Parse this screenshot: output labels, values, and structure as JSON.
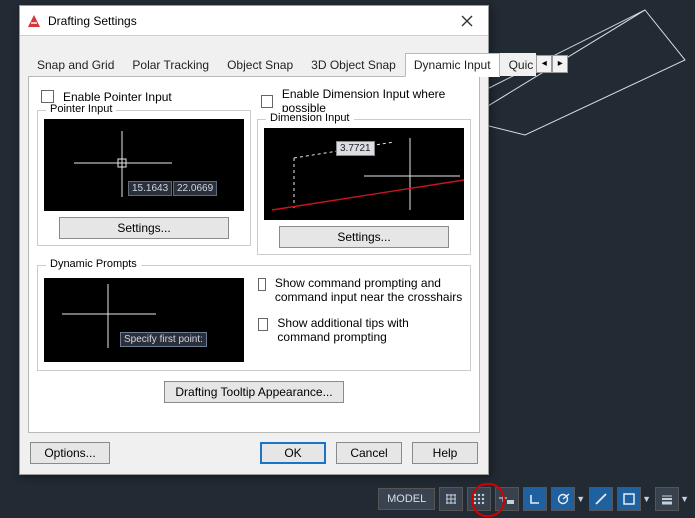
{
  "dialog": {
    "title": "Drafting Settings",
    "tabs": [
      "Snap and Grid",
      "Polar Tracking",
      "Object Snap",
      "3D Object Snap",
      "Dynamic Input",
      "Quic"
    ],
    "active_tab": "Dynamic Input",
    "enable_pointer": "Enable Pointer Input",
    "enable_dim": "Enable Dimension Input where possible",
    "pointer_group": "Pointer Input",
    "dim_group": "Dimension Input",
    "dyn_group": "Dynamic Prompts",
    "settings_label": "Settings...",
    "show_cmd": "Show command prompting and command input near the crosshairs",
    "show_tips": "Show additional tips with command prompting",
    "tooltip_btn": "Drafting Tooltip Appearance...",
    "options_btn": "Options...",
    "ok": "OK",
    "cancel": "Cancel",
    "help": "Help",
    "pointer_coord1": "15.1643",
    "pointer_coord2": "22.0669",
    "dim_value": "3.7721",
    "prompt_text": "Specify first point:"
  },
  "statusbar": {
    "model": "MODEL"
  }
}
